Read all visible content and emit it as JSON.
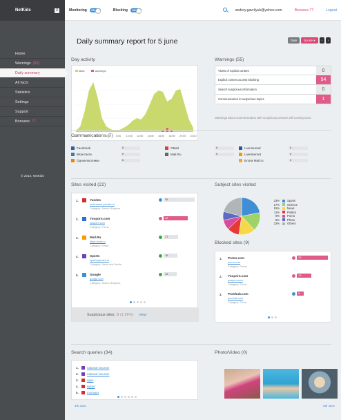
{
  "app": {
    "logo": "NetKids",
    "copyright": "© 2013, NetKids"
  },
  "sidebar": {
    "items": [
      {
        "label": "Home",
        "extra": ""
      },
      {
        "label": "Warnings",
        "extra": "(55)"
      },
      {
        "label": "Daily summary",
        "extra": ""
      },
      {
        "label": "All facts",
        "extra": ""
      },
      {
        "label": "Statistics",
        "extra": ""
      },
      {
        "label": "Settings",
        "extra": ""
      },
      {
        "label": "Support",
        "extra": ""
      },
      {
        "label": "Bonuses",
        "extra": "77"
      }
    ],
    "active_index": 2
  },
  "topbar": {
    "monitoring_label": "Monitoring",
    "monitoring_state": "ON",
    "blocking_label": "Blocking",
    "blocking_state": "ON",
    "email": "andrey.gavrilyuk@yahoo.com",
    "bonuses": "Bonuses 77",
    "logout": "Logout"
  },
  "header": {
    "title": "Daily summary report for 5 june",
    "date_btn": "Date",
    "date_select": "5 june",
    "prev": "‹",
    "next": "›"
  },
  "day_activity": {
    "title": "Day activity",
    "legend": [
      "facts",
      "warnings"
    ],
    "x_ticks": [
      "0:00",
      "2:00",
      "4:00",
      "6:00",
      "8:00",
      "10:00",
      "12:00",
      "14:00",
      "16:00",
      "18:00",
      "20:00",
      "22:00"
    ],
    "facts_series": [
      2,
      8,
      30,
      60,
      72,
      50,
      20,
      8,
      4,
      2,
      3,
      6,
      10,
      16,
      20,
      18,
      26,
      40,
      55,
      60,
      58,
      44,
      48,
      60,
      62,
      40,
      18,
      6
    ],
    "warnings_series": [
      0,
      0,
      0,
      0,
      0,
      0,
      0,
      0,
      0,
      0,
      0,
      0,
      0,
      0,
      0,
      0,
      0,
      0,
      0,
      0,
      3,
      6,
      3,
      0,
      0,
      0,
      0,
      0
    ],
    "colors": {
      "facts": "#c9d96e",
      "warnings": "#e05b87"
    }
  },
  "warnings": {
    "title": "Warnings (55)",
    "rows": [
      {
        "label": "Views of explicit content",
        "value": "0",
        "highlight": false
      },
      {
        "label": "Explicit content access blocking",
        "value": "54",
        "highlight": true
      },
      {
        "label": "Search suspicious information",
        "value": "0",
        "highlight": false
      },
      {
        "label": "Communication to suspicious topics",
        "value": "1",
        "highlight": true
      }
    ],
    "note": "Warnings about communication with suspicious persons will coming soon."
  },
  "communications": {
    "title": "Communications (7)",
    "columns": [
      [
        {
          "name": "Facebook",
          "count": "6",
          "icon": "facebook-icon",
          "color": "#3b5998"
        },
        {
          "name": "ВКонтакте",
          "count": "6",
          "icon": "vk-icon",
          "color": "#4a76a8"
        },
        {
          "name": "Одноклассники",
          "count": "6",
          "icon": "ok-icon",
          "color": "#ee8208"
        }
      ],
      [
        {
          "name": "GMail",
          "count": "6",
          "icon": "gmail-icon",
          "color": "#d44638"
        },
        {
          "name": "Mail.Ru",
          "count": "6",
          "icon": "mailru-icon",
          "color": "#666666"
        }
      ],
      [
        {
          "name": "LiveJournal",
          "count": "6",
          "icon": "livejournal-icon",
          "color": "#2c5b8b"
        },
        {
          "name": "LiveInternet",
          "count": "6",
          "icon": "liveinternet-icon",
          "color": "#e8a200"
        },
        {
          "name": "Блоги Mail.ru",
          "count": "6",
          "icon": "blogs-icon",
          "color": "#f5a623"
        }
      ]
    ]
  },
  "sites": {
    "title": "Sites visited (22)",
    "rows": [
      {
        "n": "1.",
        "name": "Yandex",
        "url": "ya.browser.yandex.ru",
        "category": "Search Engines",
        "count": "36",
        "status": "blue",
        "color": "#d32f2f"
      },
      {
        "n": "2.",
        "name": "Yooporn.com",
        "url": "yooporn.com",
        "category": "Porno",
        "count": "28",
        "status": "red",
        "color": "#2e6fc7"
      },
      {
        "n": "3.",
        "name": "Mail.Ru",
        "url": "https://mail.ru",
        "category": "Email",
        "count": "17",
        "status": "green",
        "color": "#f59d00"
      },
      {
        "n": "4.",
        "name": "Sports",
        "url": "sports.yandex.ru",
        "category": "News and Media",
        "count": "16",
        "status": "green",
        "color": "#6f3fb5"
      },
      {
        "n": "5.",
        "name": "Google",
        "url": "google.com",
        "category": "Search Engines",
        "count": "15",
        "status": "green",
        "color": "#3f8fd6"
      }
    ],
    "suspicious_label": "Suspicious sites:",
    "suspicious_count": "9",
    "suspicious_pct": "(1.99%)",
    "suspicious_link": "view"
  },
  "subject": {
    "title": "Subject sites visited",
    "items": [
      {
        "pct": "23%",
        "label": "Sports",
        "color": "#3f8fd6"
      },
      {
        "pct": "17%",
        "label": "Science",
        "color": "#9fd36a"
      },
      {
        "pct": "15%",
        "label": "News",
        "color": "#f7d84a"
      },
      {
        "pct": "11%",
        "label": "Politics",
        "color": "#e53935"
      },
      {
        "pct": "9%",
        "label": "Porno",
        "color": "#d94a9a"
      },
      {
        "pct": "8%",
        "label": "Photo",
        "color": "#5c6bc0"
      },
      {
        "pct": "22%",
        "label": "Others",
        "color": "#b0b5ba"
      }
    ]
  },
  "blocked": {
    "title": "Blocked sites (9)",
    "rows": [
      {
        "n": "1.",
        "name": "Porno.com",
        "url": "porno.com",
        "category": "Porno",
        "count": "26",
        "status": "red"
      },
      {
        "n": "2.",
        "name": "Yooporn.com",
        "url": "yooporn.com",
        "category": "Porno",
        "count": "12",
        "status": "red"
      },
      {
        "n": "3.",
        "name": "Pornhub.com",
        "url": "pornhub.com",
        "category": "Porno",
        "count": "5",
        "status": "blue"
      }
    ]
  },
  "search_queries": {
    "title": "Search queries (34)",
    "rows": [
      {
        "n": "1.",
        "text": "national insurner",
        "icon": "#6f3fb5"
      },
      {
        "n": "2.",
        "text": "national insurner",
        "icon": "#6f3fb5"
      },
      {
        "n": "3.",
        "text": "apps",
        "icon": "#d32f2f"
      },
      {
        "n": "4.",
        "text": "twitter",
        "icon": "#d32f2f"
      },
      {
        "n": "5.",
        "text": "monsant",
        "icon": "#d32f2f"
      }
    ]
  },
  "photo": {
    "title": "Photo/Video (0)"
  },
  "footer": {
    "prev": "4th June",
    "next": "6th June"
  }
}
